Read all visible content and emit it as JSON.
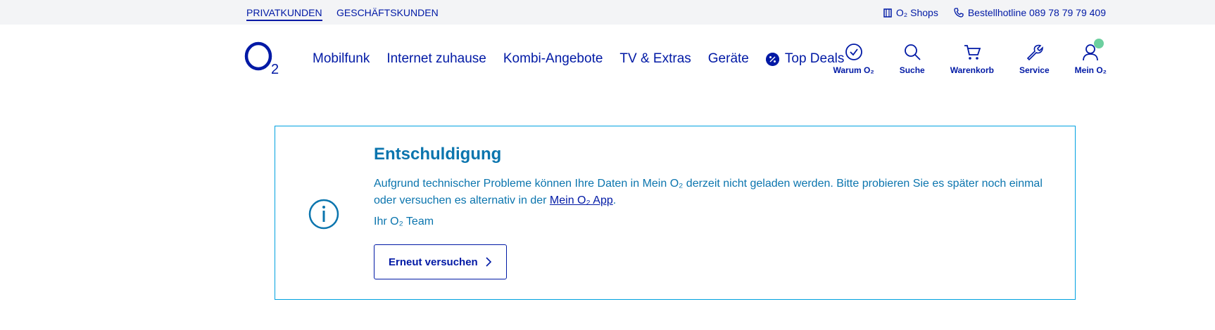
{
  "topbar": {
    "segments": [
      "PRIVATKUNDEN",
      "GESCHÄFTSKUNDEN"
    ],
    "shops_label": "O₂ Shops",
    "hotline_label": "Bestellhotline 089 78 79 79 409"
  },
  "nav": {
    "logo_text": "O₂",
    "menu": [
      "Mobilfunk",
      "Internet zuhause",
      "Kombi-Angebote",
      "TV & Extras",
      "Geräte",
      "Top Deals"
    ],
    "icons": [
      {
        "label": "Warum O₂",
        "icon": "check-circle-icon"
      },
      {
        "label": "Suche",
        "icon": "search-icon"
      },
      {
        "label": "Warenkorb",
        "icon": "cart-icon"
      },
      {
        "label": "Service",
        "icon": "wrench-icon"
      },
      {
        "label": "Mein O₂",
        "icon": "user-icon"
      }
    ]
  },
  "card": {
    "title": "Entschuldigung",
    "message_part1": "Aufgrund technischer Probleme können Ihre Daten in Mein O₂ derzeit nicht geladen werden. Bitte probieren Sie es später noch einmal oder versuchen es alternativ in der ",
    "app_link": "Mein O₂ App",
    "message_end": ".",
    "signature": "Ihr O₂ Team",
    "retry_label": "Erneut versuchen"
  },
  "colors": {
    "brand": "#0019a5",
    "info": "#0b75ae",
    "border": "#00a1e0",
    "topbar_bg": "#f3f4f6",
    "badge": "#6ccf9f"
  }
}
